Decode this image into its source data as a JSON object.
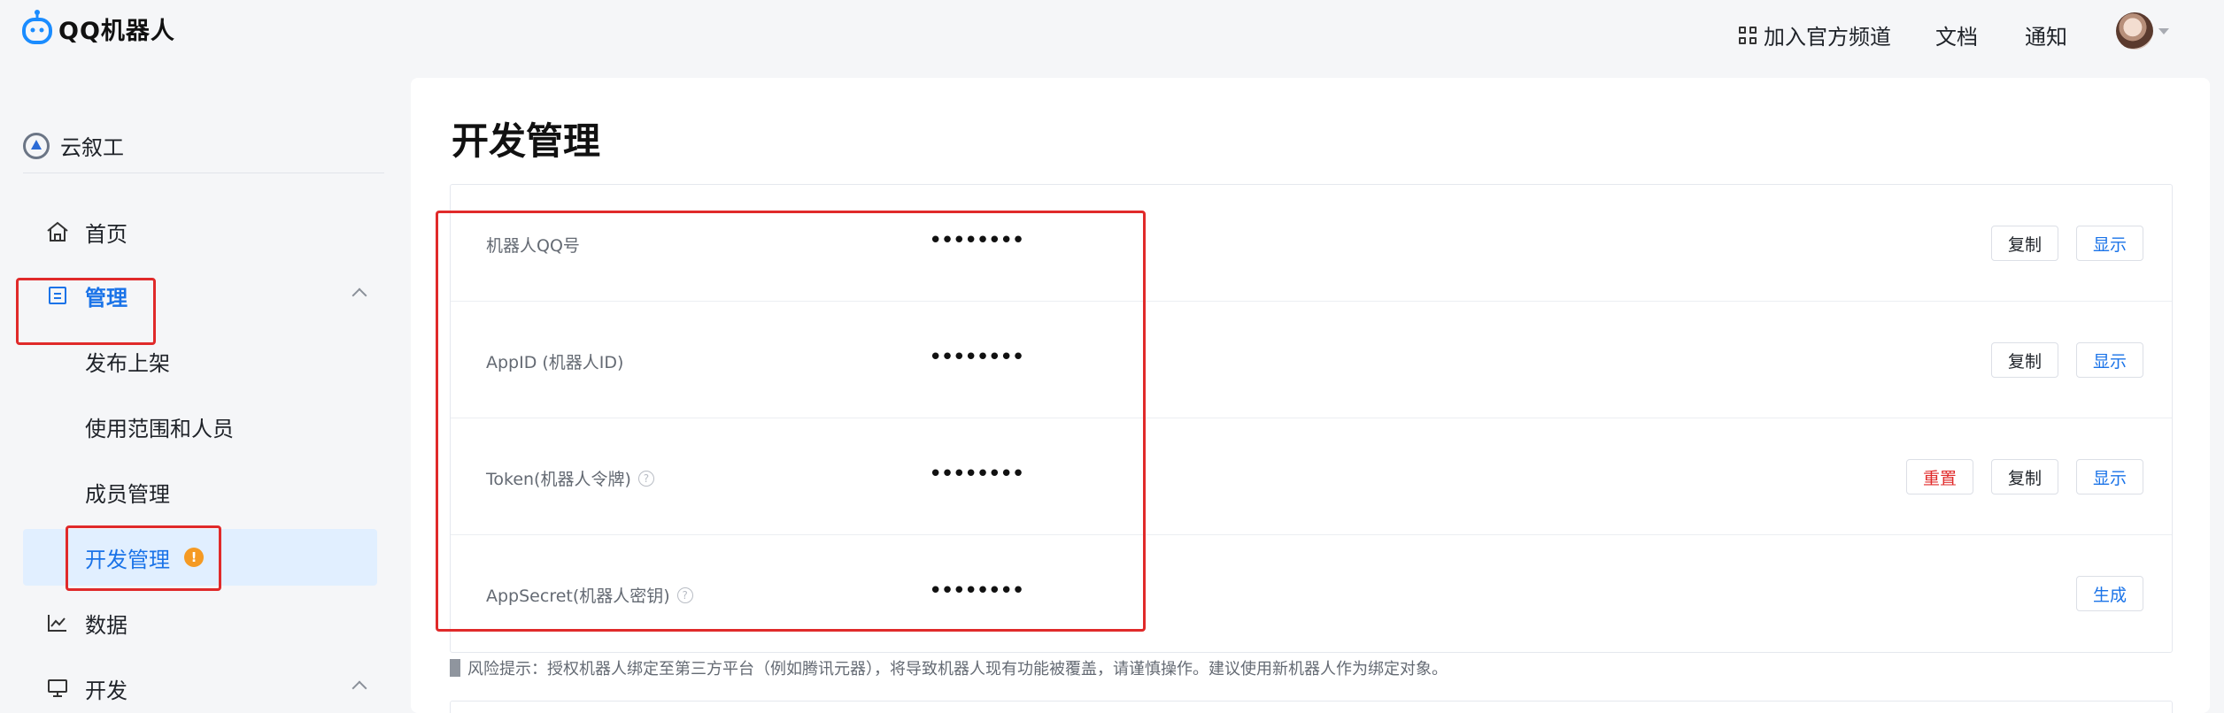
{
  "header": {
    "logo_text": "QQ机器人",
    "nav": {
      "channel": "加入官方频道",
      "docs": "文档",
      "notify": "通知"
    }
  },
  "sidebar": {
    "workspace": "云叙工",
    "items": [
      {
        "label": "首页",
        "icon": "home-icon"
      },
      {
        "label": "管理",
        "icon": "manage-icon"
      },
      {
        "label": "发布上架"
      },
      {
        "label": "使用范围和人员"
      },
      {
        "label": "成员管理"
      },
      {
        "label": "开发管理",
        "badge": "!"
      },
      {
        "label": "数据",
        "icon": "chart-icon"
      },
      {
        "label": "开发",
        "icon": "monitor-icon"
      }
    ]
  },
  "main": {
    "title": "开发管理",
    "credentials": [
      {
        "label": "机器人QQ号",
        "value": "••••••••",
        "actions": [
          "复制",
          "显示"
        ]
      },
      {
        "label": "AppID (机器人ID)",
        "value": "••••••••",
        "actions": [
          "复制",
          "显示"
        ]
      },
      {
        "label": "Token(机器人令牌)",
        "value": "••••••••",
        "actions": [
          "重置",
          "复制",
          "显示"
        ],
        "help": "?"
      },
      {
        "label": "AppSecret(机器人密钥)",
        "value": "••••••••",
        "actions": [
          "生成"
        ],
        "help": "?"
      }
    ],
    "risk_tip": "风险提示：授权机器人绑定至第三方平台（例如腾讯元器），将导致机器人现有功能被覆盖，请谨慎操作。建议使用新机器人作为绑定对象。"
  },
  "colors": {
    "accent": "#1a73e8",
    "danger": "#e02a2a",
    "warning": "#f59a23",
    "highlight_box": "#e02a2a"
  }
}
